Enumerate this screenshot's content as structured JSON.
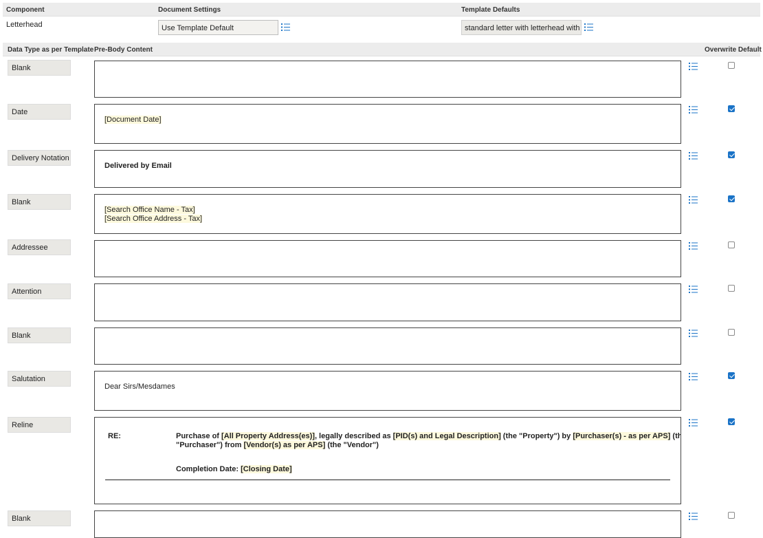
{
  "header1": {
    "component": "Component",
    "document_settings": "Document Settings",
    "template_defaults": "Template Defaults"
  },
  "letterhead": {
    "component": "Letterhead",
    "document_setting": "Use Template Default",
    "template_default": "standard letter with letterhead with"
  },
  "header2": {
    "data_type": "Data Type as per Template",
    "pre_body": "Pre-Body Content",
    "overwrite": "Overwrite Default"
  },
  "rows": [
    {
      "type": "Blank",
      "overwrite": false,
      "content": []
    },
    {
      "type": "Date",
      "overwrite": true,
      "content": [
        "[Document Date]"
      ]
    },
    {
      "type": "Delivery Notation",
      "overwrite": true,
      "content": [
        "Delivered by Email"
      ]
    },
    {
      "type": "Blank",
      "overwrite": true,
      "content": [
        "[Search Office Name - Tax]",
        "[Search Office Address - Tax]"
      ]
    },
    {
      "type": "Addressee",
      "overwrite": false,
      "content": []
    },
    {
      "type": "Attention",
      "overwrite": false,
      "content": []
    },
    {
      "type": "Blank",
      "overwrite": false,
      "content": []
    },
    {
      "type": "Salutation",
      "overwrite": true,
      "content": [
        "Dear Sirs/Mesdames"
      ]
    },
    {
      "type": "Reline",
      "overwrite": true,
      "content": []
    },
    {
      "type": "Blank",
      "overwrite": false,
      "content": []
    }
  ],
  "reline": {
    "re_label": "RE:",
    "line1": {
      "t1": "Purchase of ",
      "f1": "[All Property Address(es)]",
      "t2": ", legally described as ",
      "f2": "[PID(s) and Legal Description]",
      "t3": " (the \"Property\") by ",
      "f3": "[Purchaser(s) - as per APS]",
      "t4": " (the"
    },
    "line2": {
      "t1": "\"Purchaser\") from ",
      "f1": "[Vendor(s) as per APS]",
      "t2": " (the \"Vendor\")"
    },
    "completion": {
      "label": "Completion Date: ",
      "field": "[Closing Date]"
    }
  },
  "colors": {
    "accent": "#1a73c7",
    "header_bg": "#ececec",
    "field_highlight": "#fdf9dd"
  },
  "icons": {
    "list": "list-icon"
  }
}
